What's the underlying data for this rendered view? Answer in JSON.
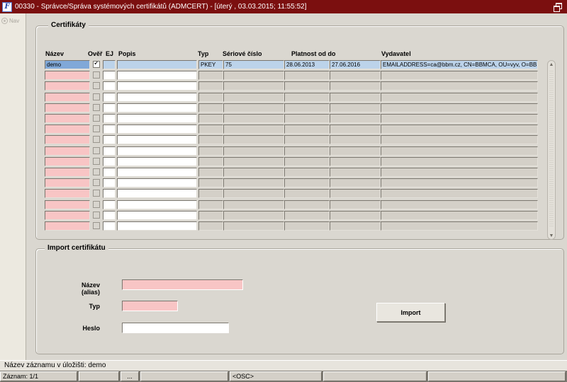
{
  "window": {
    "title": "00330 - Správce/Správa systémových certifikátů (ADMCERT) - [úterý  , 03.03.2015; 11:55:52]"
  },
  "nav": {
    "label": "Nav"
  },
  "certificates": {
    "legend": "Certifikáty",
    "columns": {
      "nazev": "Název",
      "over": "Ověř",
      "ej": "EJ",
      "popis": "Popis",
      "typ": "Typ",
      "serial": "Sériové číslo",
      "platnost": "Platnost od do",
      "vydavatel": "Vydavatel"
    },
    "rows": [
      {
        "nazev": "demo",
        "over_checked": true,
        "popis": "",
        "typ": "PKEY",
        "serial": "75",
        "platnost_od": "28.06.2013",
        "platnost_do": "27.06.2016",
        "vydavatel": "EMAILADDRESS=ca@bbm.cz, CN=BBMCA, OU=vyv, O=BBM"
      }
    ],
    "empty_rows": 15
  },
  "import": {
    "legend": "Import certifikátu",
    "alias_label": "Název (alias)",
    "alias_value": "",
    "typ_label": "Typ",
    "typ_value": "",
    "heslo_label": "Heslo",
    "heslo_value": "",
    "button_label": "Import"
  },
  "status": {
    "message": "Název záznamu v úložišti: demo",
    "record": "Záznam: 1/1",
    "cell3": "",
    "cell4": "...",
    "cell5": "",
    "osc": "<OSC>",
    "cell7": "",
    "cell8": ""
  },
  "colors": {
    "titlebar": "#7b0f0f",
    "required_field": "#f8c5c5",
    "current_row": "#bcd3ea"
  }
}
